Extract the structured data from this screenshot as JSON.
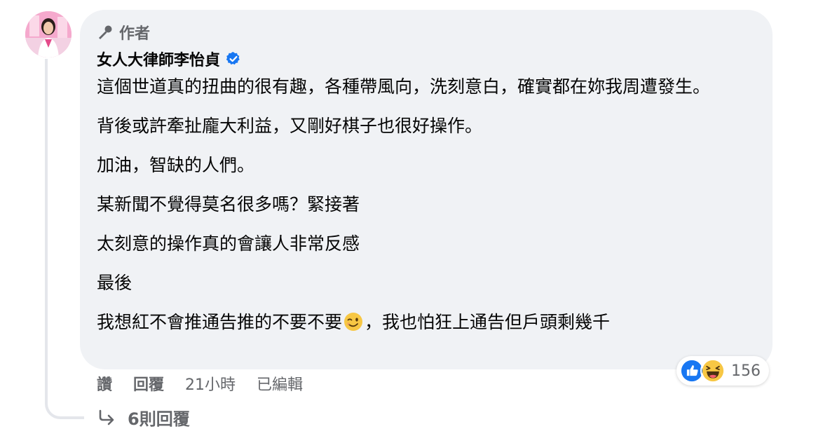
{
  "comment": {
    "author_badge": "作者",
    "author_name": "女人大律師李怡貞",
    "verified": true,
    "paragraphs": [
      "這個世道真的扭曲的很有趣，各種帶風向，洗刻意白，確實都在妳我周遭發生。",
      "背後或許牽扯龐大利益，又剛好棋子也很好操作。",
      "加油，智缺的人們。",
      "某新聞不覺得莫名很多嗎？緊接著",
      "太刻意的操作真的會讓人非常反感",
      "最後"
    ],
    "last_paragraph_before_emoji": "我想紅不會推通告推的不要不要",
    "last_paragraph_after_emoji": "，我也怕狂上通告但戶頭剩幾千",
    "inline_emoji": "winking-face-emoji"
  },
  "reactions": {
    "icons": [
      "like-reaction-icon",
      "haha-reaction-icon"
    ],
    "count": "156"
  },
  "actions": {
    "like": "讚",
    "reply": "回覆",
    "time": "21小時",
    "edited": "已編輯"
  },
  "replies": {
    "label": "6則回覆"
  },
  "colors": {
    "bubble": "#f0f2f5",
    "secondary_text": "#65676b",
    "verified_blue": "#1877f2",
    "thread_line": "#e4e6eb"
  }
}
